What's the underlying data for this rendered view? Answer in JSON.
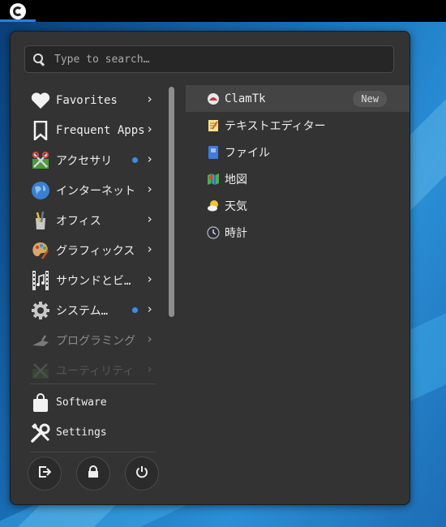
{
  "search": {
    "placeholder": "Type to search…"
  },
  "categories": [
    {
      "label": "Favorites",
      "icon": "heart-icon",
      "dot": false
    },
    {
      "label": "Frequent Apps",
      "icon": "bookmark-icon",
      "dot": false
    },
    {
      "label": "アクセサリ",
      "icon": "accessories-icon",
      "dot": true
    },
    {
      "label": "インターネット",
      "icon": "globe-icon",
      "dot": false
    },
    {
      "label": "オフィス",
      "icon": "office-icon",
      "dot": false
    },
    {
      "label": "グラフィックス",
      "icon": "palette-icon",
      "dot": false
    },
    {
      "label": "サウンドとビ…",
      "icon": "film-icon",
      "dot": false
    },
    {
      "label": "システム…",
      "icon": "gear-icon",
      "dot": true
    },
    {
      "label": "プログラミング",
      "icon": "trowel-icon",
      "dot": false
    },
    {
      "label": "ユーティリティ",
      "icon": "utilities-icon",
      "dot": false
    }
  ],
  "bottom": {
    "software": "Software",
    "settings": "Settings"
  },
  "apps": [
    {
      "label": "ClamTk",
      "icon": "clamtk-icon",
      "badge": "New"
    },
    {
      "label": "テキストエディター",
      "icon": "text-editor-icon"
    },
    {
      "label": "ファイル",
      "icon": "files-icon"
    },
    {
      "label": "地図",
      "icon": "maps-icon"
    },
    {
      "label": "天気",
      "icon": "weather-icon"
    },
    {
      "label": "時計",
      "icon": "clock-icon"
    }
  ],
  "colors": {
    "accent": "#3b8ee8",
    "menu_bg": "#333333"
  }
}
